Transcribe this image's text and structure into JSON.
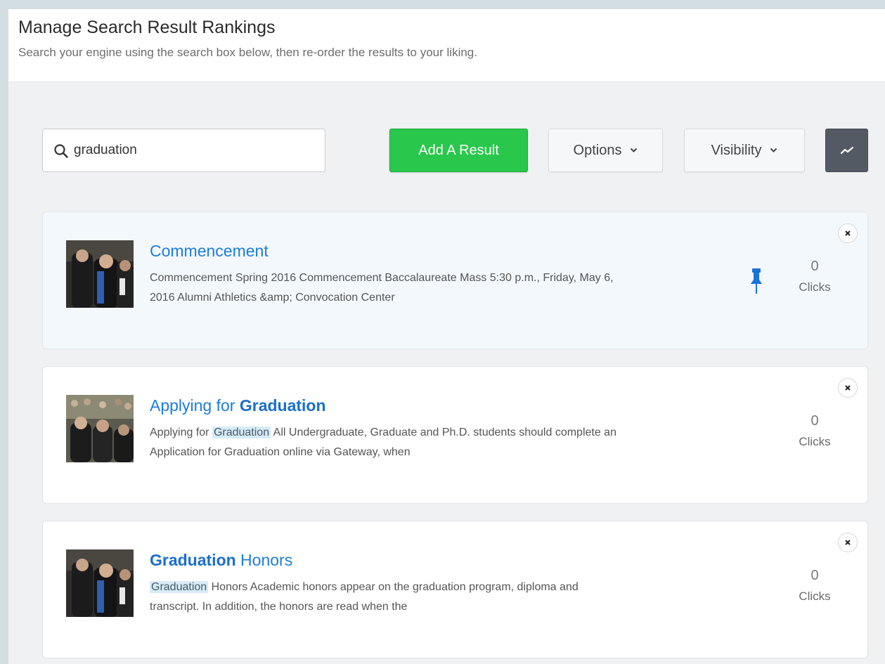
{
  "header": {
    "title": "Manage Search Result Rankings",
    "subtitle": "Search your engine using the search box below, then re-order the results to your liking."
  },
  "toolbar": {
    "search_value": "graduation",
    "add_label": "Add A Result",
    "options_label": "Options",
    "visibility_label": "Visibility",
    "chart_icon": "trend-line-icon"
  },
  "results": [
    {
      "title_pre": "Commencement",
      "title_bold": "",
      "title_post": "",
      "desc_pre": "",
      "desc_hl": "",
      "desc_post": "Commencement Spring 2016 Commencement Baccalaureate Mass 5:30 p.m., Friday, May 6, 2016 Alumni Athletics &amp; Convocation Center",
      "clicks_count": "0",
      "clicks_label": "Clicks",
      "pinned": true
    },
    {
      "title_pre": "Applying for ",
      "title_bold": "Graduation",
      "title_post": "",
      "desc_pre": "Applying for ",
      "desc_hl": "Graduation",
      "desc_post": " All Undergraduate, Graduate and Ph.D. students should complete an Application for Graduation online via Gateway, when",
      "clicks_count": "0",
      "clicks_label": "Clicks",
      "pinned": false
    },
    {
      "title_pre": "",
      "title_bold": "Graduation",
      "title_post": " Honors",
      "desc_pre": "",
      "desc_hl": "Graduation",
      "desc_post": " Honors Academic honors appear on the graduation program, diploma and transcript.  In addition, the honors are read when the",
      "clicks_count": "0",
      "clicks_label": "Clicks",
      "pinned": false
    }
  ],
  "colors": {
    "accent_green": "#29c74b",
    "link_blue": "#1e7dd6",
    "pin_blue": "#1a73d9",
    "highlight": "#d6ebf7"
  }
}
